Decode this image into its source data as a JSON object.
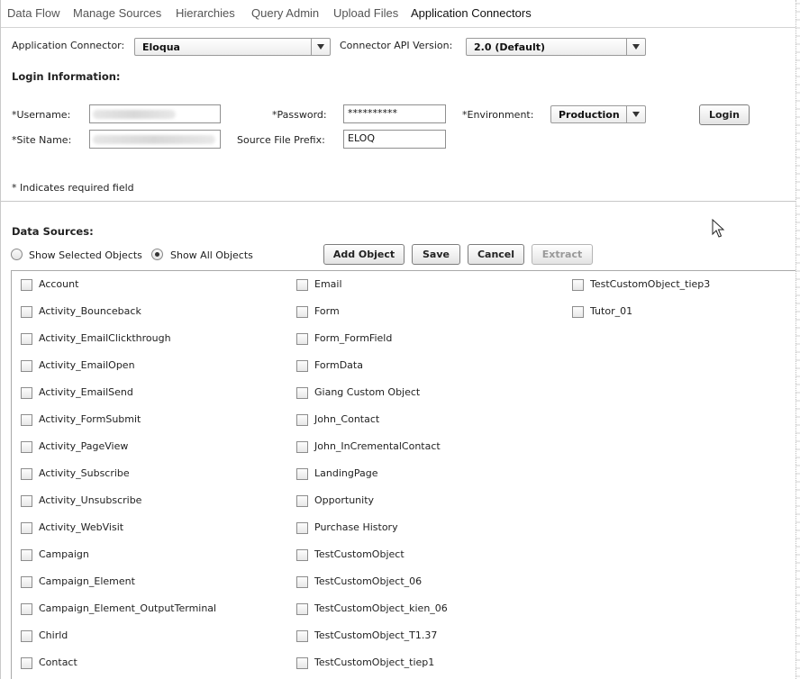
{
  "tabs": [
    {
      "label": "Data Flow",
      "active": false
    },
    {
      "label": "Manage Sources",
      "active": false
    },
    {
      "label": "Hierarchies",
      "active": false
    },
    {
      "label": "Query Admin",
      "active": false
    },
    {
      "label": "Upload Files",
      "active": false
    },
    {
      "label": "Application Connectors",
      "active": true
    }
  ],
  "connector": {
    "app_label": "Application Connector:",
    "app_value": "Eloqua",
    "api_label": "Connector API Version:",
    "api_value": "2.0 (Default)"
  },
  "login": {
    "section_title": "Login Information:",
    "username_label": "*Username:",
    "password_label": "*Password:",
    "password_value": "**********",
    "environment_label": "*Environment:",
    "environment_value": "Production",
    "login_button": "Login",
    "site_label": "*Site Name:",
    "prefix_label": "Source File Prefix:",
    "prefix_value": "ELOQ",
    "required_note": "* Indicates required field"
  },
  "data_sources": {
    "section_title": "Data Sources:",
    "radio_selected_label": "Show Selected Objects",
    "radio_all_label": "Show All Objects",
    "radio_checked": "all",
    "buttons": {
      "add": "Add Object",
      "save": "Save",
      "cancel": "Cancel",
      "extract": "Extract"
    },
    "columns": [
      [
        "Account",
        "Activity_Bounceback",
        "Activity_EmailClickthrough",
        "Activity_EmailOpen",
        "Activity_EmailSend",
        "Activity_FormSubmit",
        "Activity_PageView",
        "Activity_Subscribe",
        "Activity_Unsubscribe",
        "Activity_WebVisit",
        "Campaign",
        "Campaign_Element",
        "Campaign_Element_OutputTerminal",
        "Chirld",
        "Contact"
      ],
      [
        "Email",
        "Form",
        "Form_FormField",
        "FormData",
        "Giang Custom Object",
        "John_Contact",
        "John_InCrementalContact",
        "LandingPage",
        "Opportunity",
        "Purchase History",
        "TestCustomObject",
        "TestCustomObject_06",
        "TestCustomObject_kien_06",
        "TestCustomObject_T1.37",
        "TestCustomObject_tiep1"
      ],
      [
        "TestCustomObject_tiep3",
        "Tutor_01"
      ]
    ]
  }
}
